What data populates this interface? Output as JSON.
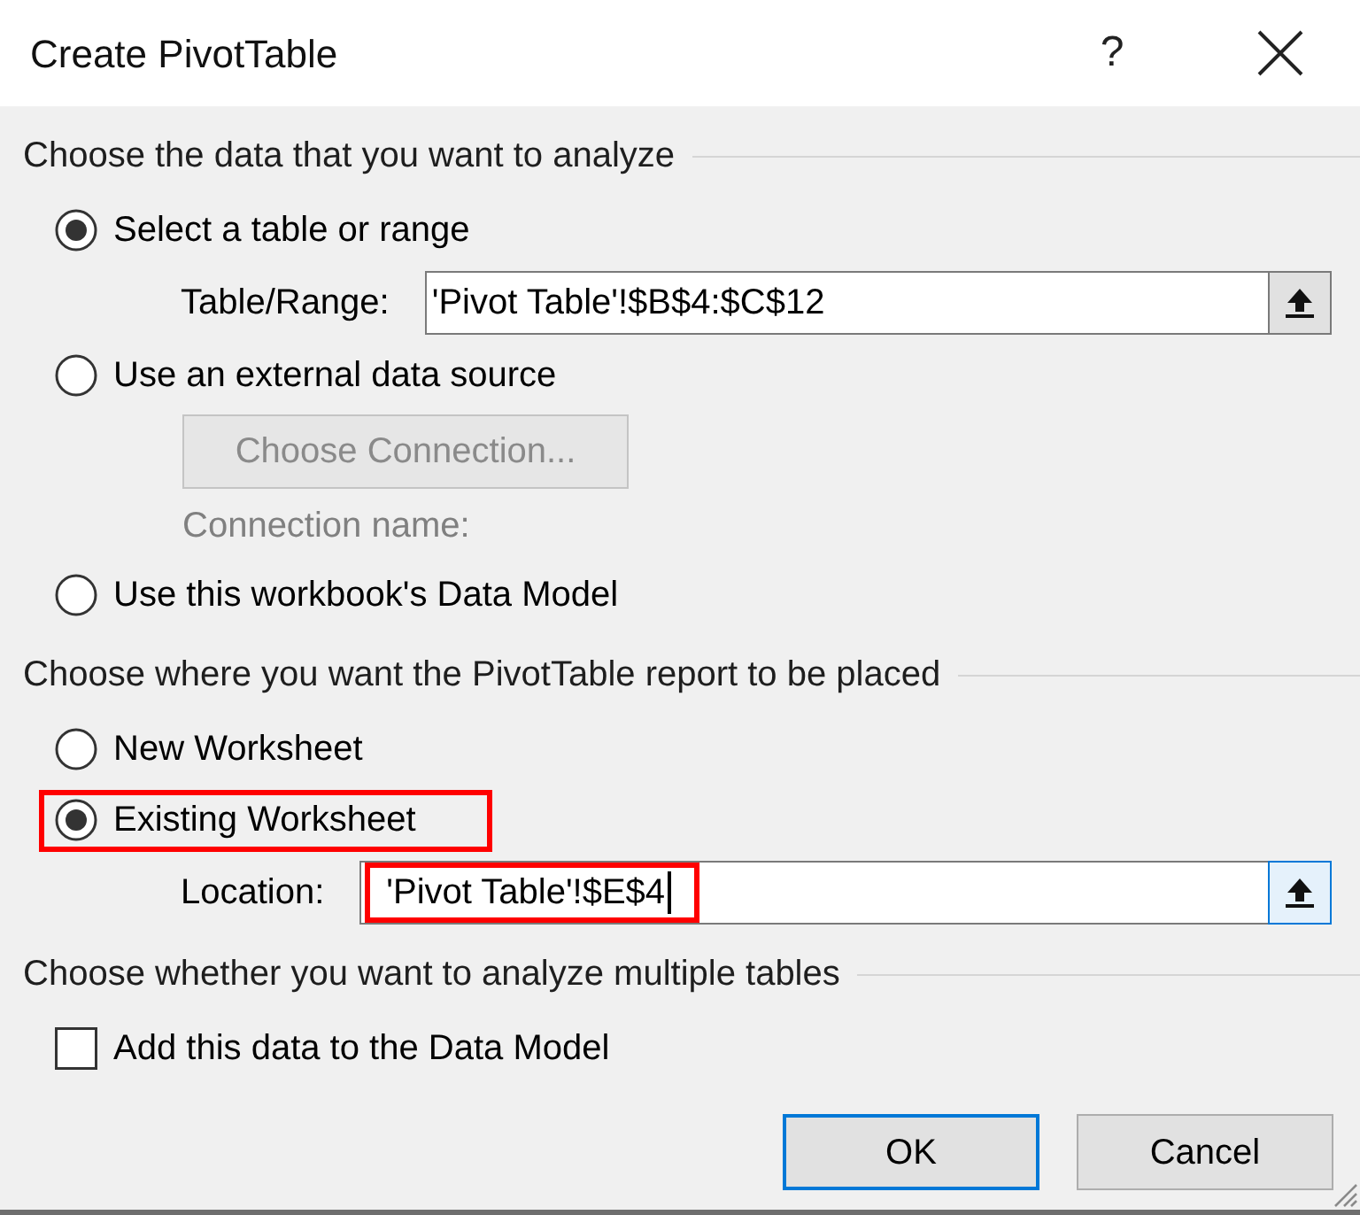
{
  "window": {
    "title": "Create PivotTable",
    "help_label": "?"
  },
  "sections": [
    {
      "heading": "Choose the data that you want to analyze",
      "items": [
        {
          "kind": "radio",
          "label": "Select a table or range",
          "selected": true,
          "highlighted": false
        },
        {
          "kind": "field",
          "label": "Table/Range:",
          "value": "'Pivot Table'!$B$4:$C$12",
          "focused": false,
          "highlighted": false
        },
        {
          "kind": "radio",
          "label": "Use an external data source",
          "selected": false,
          "highlighted": false
        },
        {
          "kind": "button",
          "label": "Choose Connection...",
          "disabled": true
        },
        {
          "kind": "note",
          "label": "Connection name:",
          "disabled": true
        },
        {
          "kind": "radio",
          "label": "Use this workbook's Data Model",
          "selected": false,
          "highlighted": false
        }
      ]
    },
    {
      "heading": "Choose where you want the PivotTable report to be placed",
      "items": [
        {
          "kind": "radio",
          "label": "New Worksheet",
          "selected": false,
          "highlighted": false
        },
        {
          "kind": "radio",
          "label": "Existing Worksheet",
          "selected": true,
          "highlighted": true
        },
        {
          "kind": "field",
          "label": "Location:",
          "value": "'Pivot Table'!$E$4",
          "focused": true,
          "highlighted": true
        }
      ]
    },
    {
      "heading": "Choose whether you want to analyze multiple tables",
      "items": [
        {
          "kind": "checkbox",
          "label": "Add this data to the Data Model",
          "checked": false
        }
      ]
    }
  ],
  "buttons": [
    {
      "label": "OK",
      "default": true
    },
    {
      "label": "Cancel",
      "default": false
    }
  ]
}
